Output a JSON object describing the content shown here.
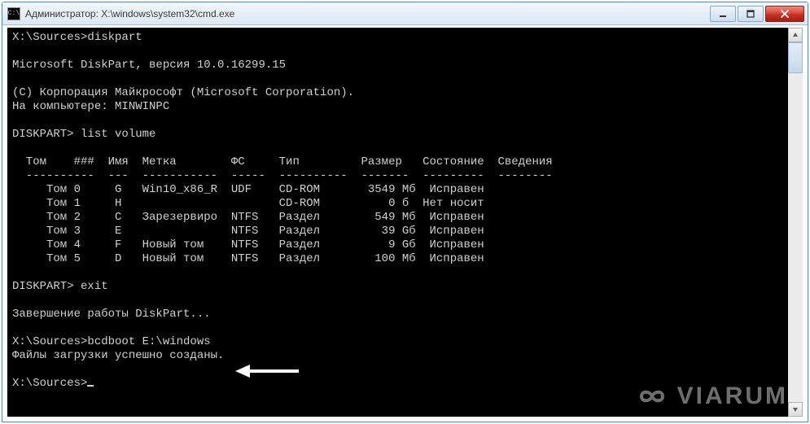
{
  "title": "Администратор: X:\\windows\\system32\\cmd.exe",
  "console": {
    "line01": "X:\\Sources>diskpart",
    "line02": "",
    "line03": "Microsoft DiskPart, версия 10.0.16299.15",
    "line04": "",
    "line05": "(C) Корпорация Майкрософт (Microsoft Corporation).",
    "line06": "На компьютере: MINWINPC",
    "line07": "",
    "line08": "DISKPART> list volume",
    "line09": "",
    "line10": "  Том    ###  Имя  Метка        ФС     Тип         Размер   Состояние  Сведения",
    "line11": "  ----------  ---  -----------  -----  ----------  -------  ---------  --------",
    "line12": "     Том 0     G   Win10_x86_R  UDF    CD-ROM       3549 Мб  Исправен",
    "line13": "     Том 1     H                       CD-ROM          0 б  Нет носит",
    "line14": "     Том 2     C   Зарезервиро  NTFS   Раздел        549 Мб  Исправен",
    "line15": "     Том 3     E                NTFS   Раздел         39 Gб  Исправен",
    "line16": "     Том 4     F   Новый том    NTFS   Раздел          9 Gб  Исправен",
    "line17": "     Том 5     D   Новый том    NTFS   Раздел        100 Мб  Исправен",
    "line18": "",
    "line19": "DISKPART> exit",
    "line20": "",
    "line21": "Завершение работы DiskPart...",
    "line22": "",
    "line23": "X:\\Sources>bcdboot E:\\windows",
    "line24": "Файлы загрузки успешно созданы.",
    "line25": "",
    "line26": "X:\\Sources>"
  },
  "watermark": "VIARUM"
}
